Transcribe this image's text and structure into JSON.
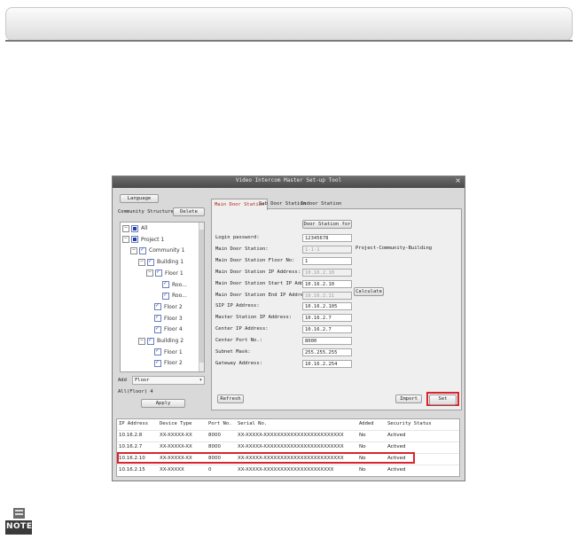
{
  "window": {
    "title": "Video Intercom Master Set-up Tool",
    "close_symbol": "×"
  },
  "top": {
    "language_button": "Language",
    "community_structure_label": "Community Structure",
    "delete_button": "Delete"
  },
  "tree": [
    {
      "label": "All",
      "box": "square"
    },
    {
      "label": "Project 1",
      "box": "square"
    },
    {
      "label": "Community 1",
      "box": "check"
    },
    {
      "label": "Building 1",
      "box": "check"
    },
    {
      "label": "Floor 1",
      "box": "check"
    },
    {
      "label": "Roo...",
      "box": "check"
    },
    {
      "label": "Roo...",
      "box": "check"
    },
    {
      "label": "Floor 2",
      "box": "check"
    },
    {
      "label": "Floor 3",
      "box": "check"
    },
    {
      "label": "Floor 4",
      "box": "check"
    },
    {
      "label": "Building 2",
      "box": "check"
    },
    {
      "label": "Floor 1",
      "box": "check"
    },
    {
      "label": "Floor 2",
      "box": "check"
    }
  ],
  "add": {
    "label": "Add",
    "value": "Floor",
    "all_floor_text": "All(Floor) 4",
    "apply_button": "Apply"
  },
  "tabs": [
    "Main Door Station",
    "Sub Door Station",
    "Indoor Station"
  ],
  "form": {
    "door_station_button": "Door Station for",
    "rows": [
      {
        "label": "Login password:",
        "value": "12345678",
        "disabled": false
      },
      {
        "label": "Main Door Station:",
        "value": "1-1-1",
        "disabled": true
      },
      {
        "label": "Main Door Station Floor No:",
        "value": "1",
        "disabled": false
      },
      {
        "label": "Main Door Station IP Address:",
        "value": "10.16.2.10",
        "disabled": true
      },
      {
        "label": "Main Door Station Start IP Address:",
        "value": "10.16.2.10",
        "disabled": false
      },
      {
        "label": "Main Door Station End IP Address:",
        "value": "10.16.2.11",
        "disabled": true
      },
      {
        "label": "SIP IP Address:",
        "value": "10.16.2.105",
        "disabled": false
      },
      {
        "label": "Master Station IP Address:",
        "value": "10.16.2.7",
        "disabled": false
      },
      {
        "label": "Center IP Address:",
        "value": "10.16.2.7",
        "disabled": false
      },
      {
        "label": "Center Port No.:",
        "value": "8000",
        "disabled": false
      },
      {
        "label": "Subnet Mask:",
        "value": "255.255.255",
        "disabled": false
      },
      {
        "label": "Gateway Address:",
        "value": "10.16.2.254",
        "disabled": false
      }
    ],
    "side_note": "Project-Community-Building",
    "calculate_button": "Calculate"
  },
  "bottom_buttons": {
    "refresh": "Refresh",
    "import": "Import",
    "set": "Set"
  },
  "table": {
    "columns": [
      "IP Address",
      "Device Type",
      "Port No.",
      "Serial No.",
      "Added",
      "Security Status"
    ],
    "rows": [
      [
        "10.16.2.8",
        "XX-XXXXX-XX",
        "8000",
        "XX-XXXXX-XXXXXXXXXXXXXXXXXXXXXXXX",
        "No",
        "Actived"
      ],
      [
        "10.16.2.7",
        "XX-XXXXX-XX",
        "8000",
        "XX-XXXXX-XXXXXXXXXXXXXXXXXXXXXXXX",
        "No",
        "Actived"
      ],
      [
        "10.16.2.10",
        "XX-XXXXX-XX",
        "8000",
        "XX-XXXXX-XXXXXXXXXXXXXXXXXXXXXXXX",
        "No",
        "Actived"
      ],
      [
        "10.16.2.15",
        "XX-XXXXX",
        "0",
        "XX-XXXXX-XXXXXXXXXXXXXXXXXXXXX",
        "No",
        "Actived"
      ]
    ],
    "highlighted_row": 2
  },
  "note": {
    "label": "NOTE",
    "icon": "note-icon"
  },
  "colors": {
    "highlight": "#d9242e",
    "title_bar": "#5a5a5a"
  }
}
